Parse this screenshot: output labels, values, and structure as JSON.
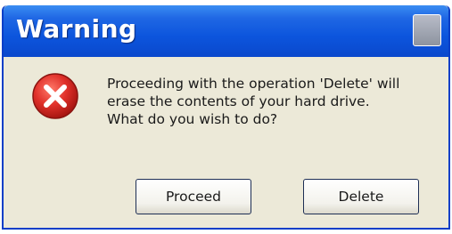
{
  "window": {
    "title": "Warning"
  },
  "dialog": {
    "icon": "error-icon",
    "message_lines": [
      "Proceeding with the operation 'Delete' will",
      "erase the contents of your hard drive.",
      "What do you wish to do?"
    ]
  },
  "buttons": {
    "proceed_label": "Proceed",
    "delete_label": "Delete"
  },
  "colors": {
    "titlebar": "#0c55dd",
    "dialog_background": "#ece9d8",
    "error_red": "#e0302a"
  }
}
